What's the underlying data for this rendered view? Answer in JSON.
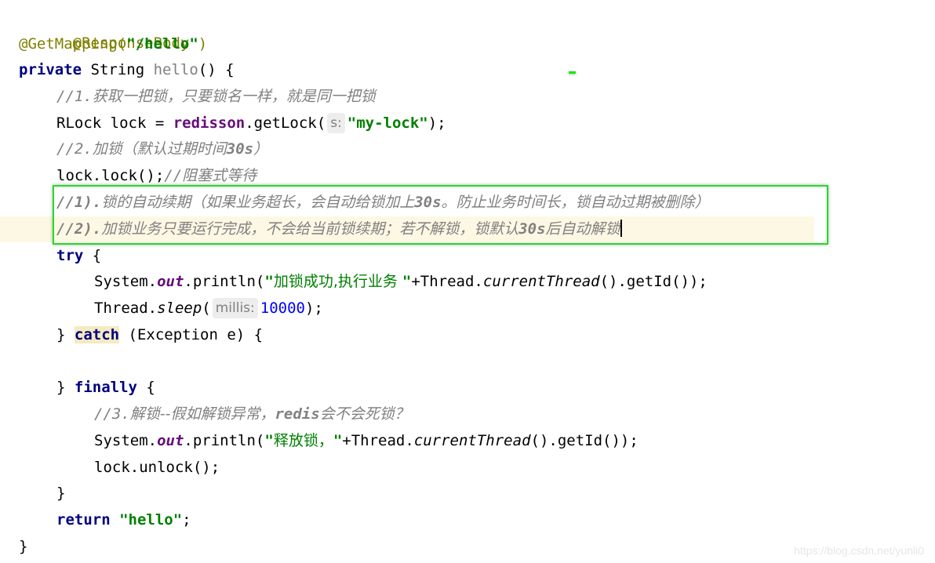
{
  "editor": {
    "language": "java",
    "colors": {
      "annotation": "#808000",
      "keyword": "#000080",
      "string": "#008000",
      "comment": "#808080",
      "field": "#660e7a",
      "number": "#0000ff",
      "caret_line": "#fdf8e4",
      "selection_box": "#22dd22",
      "match_highlight": "#f5eac1"
    },
    "lines": {
      "l1": {
        "annotation": "@ResponseBody"
      },
      "l2": {
        "annotation": "@GetMapping(",
        "string": "\"/hello\"",
        "close": ")"
      },
      "l3": {
        "kw": "private",
        "type": " String ",
        "name": "hello",
        "rest": "() {"
      },
      "l4": {
        "prefix": "//1.",
        "text": "获取一把锁，只要锁名一样，就是同一把锁"
      },
      "l5": {
        "pre": "RLock lock = ",
        "field": "redisson",
        "call": ".getLock(",
        "hint": "s:",
        "string": "\"my-lock\"",
        "end": ");"
      },
      "l6": {
        "prefix": "//2.",
        "text_a": "加锁（默认过期时间",
        "bold": "30s",
        "text_b": "）"
      },
      "l7": {
        "code": "lock.lock();",
        "comment_prefix": "//",
        "comment": "阻塞式等待"
      },
      "l8": {
        "prefix": "//1).",
        "text_a": "锁的自动续期（如果业务超长，会自动给锁加上",
        "bold": "30s",
        "text_b": "。防止业务时间长，锁自动过期被删除）"
      },
      "l9": {
        "prefix": "//2).",
        "text_a": "加锁业务只要运行完成，不会给当前锁续期；若不解锁，锁默认",
        "bold": "30s",
        "text_b": "后自动解锁"
      },
      "l10": {
        "kw": "try",
        "rest": " {"
      },
      "l11": {
        "pre": "System.",
        "field": "out",
        "call": ".println(",
        "q1": "\"",
        "cn": "加锁成功,执行业务 ",
        "q2": "\"",
        "plus": "+Thread.",
        "method": "currentThread",
        "end": "().getId());"
      },
      "l12": {
        "pre": "Thread.",
        "method": "sleep",
        "open": "(",
        "hint": "millis:",
        "number": "10000",
        "end": ");"
      },
      "l13": {
        "brace": "} ",
        "kw": "catch",
        "rest": " (Exception e) {"
      },
      "l15": {
        "brace": "} ",
        "kw": "finally",
        "rest": " {"
      },
      "l16": {
        "prefix": "//3.",
        "text_a": "解锁--假如解锁异常，",
        "bold": "redis",
        "text_b": "会不会死锁？"
      },
      "l17": {
        "pre": "System.",
        "field": "out",
        "call": ".println(",
        "q1": "\"",
        "cn": "释放锁，",
        "q2": "\"",
        "plus": "+Thread.",
        "method": "currentThread",
        "end": "().getId());"
      },
      "l18": {
        "code": "lock.unlock();"
      },
      "l19": {
        "code": "}"
      },
      "l20": {
        "kw": "return",
        "sp": " ",
        "string": "\"hello\"",
        "end": ";"
      },
      "l21": {
        "code": "}"
      }
    }
  },
  "watermark": "https://blog.csdn.net/yunli0"
}
